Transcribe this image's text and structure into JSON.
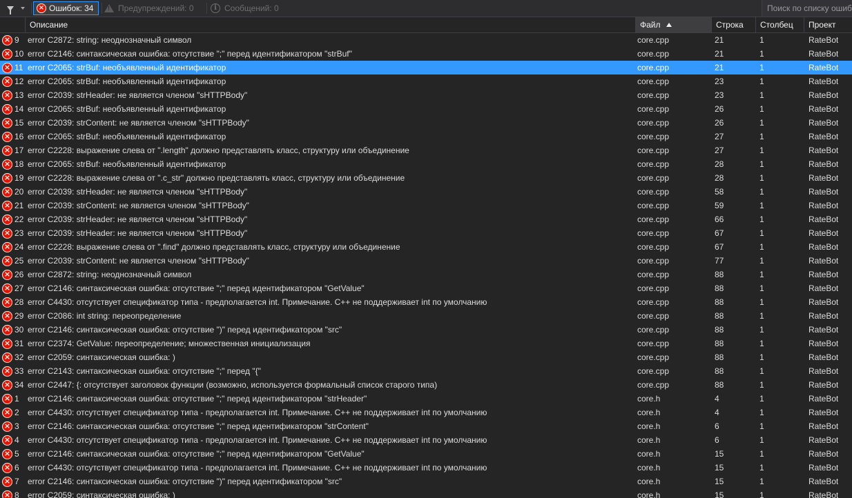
{
  "toolbar": {
    "errors_label": "Ошибок: 34",
    "warnings_label": "Предупреждений: 0",
    "messages_label": "Сообщений: 0",
    "search_placeholder": "Поиск по списку ошибок"
  },
  "columns": {
    "description": "Описание",
    "file": "Файл",
    "line": "Строка",
    "column": "Столбец",
    "project": "Проект"
  },
  "selected_index": 2,
  "rows": [
    {
      "n": "9",
      "desc": "error C2872: string: неоднозначный символ",
      "file": "core.cpp",
      "line": "21",
      "col": "1",
      "proj": "RateBot"
    },
    {
      "n": "10",
      "desc": "error C2146: синтаксическая ошибка: отсутствие \";\" перед идентификатором \"strBuf\"",
      "file": "core.cpp",
      "line": "21",
      "col": "1",
      "proj": "RateBot"
    },
    {
      "n": "11",
      "desc": "error C2065: strBuf: необъявленный идентификатор",
      "file": "core.cpp",
      "line": "21",
      "col": "1",
      "proj": "RateBot"
    },
    {
      "n": "12",
      "desc": "error C2065: strBuf: необъявленный идентификатор",
      "file": "core.cpp",
      "line": "23",
      "col": "1",
      "proj": "RateBot"
    },
    {
      "n": "13",
      "desc": "error C2039: strHeader: не является членом \"sHTTPBody\"",
      "file": "core.cpp",
      "line": "23",
      "col": "1",
      "proj": "RateBot"
    },
    {
      "n": "14",
      "desc": "error C2065: strBuf: необъявленный идентификатор",
      "file": "core.cpp",
      "line": "26",
      "col": "1",
      "proj": "RateBot"
    },
    {
      "n": "15",
      "desc": "error C2039: strContent: не является членом \"sHTTPBody\"",
      "file": "core.cpp",
      "line": "26",
      "col": "1",
      "proj": "RateBot"
    },
    {
      "n": "16",
      "desc": "error C2065: strBuf: необъявленный идентификатор",
      "file": "core.cpp",
      "line": "27",
      "col": "1",
      "proj": "RateBot"
    },
    {
      "n": "17",
      "desc": "error C2228: выражение слева от \".length\" должно представлять класс, структуру или объединение",
      "file": "core.cpp",
      "line": "27",
      "col": "1",
      "proj": "RateBot"
    },
    {
      "n": "18",
      "desc": "error C2065: strBuf: необъявленный идентификатор",
      "file": "core.cpp",
      "line": "28",
      "col": "1",
      "proj": "RateBot"
    },
    {
      "n": "19",
      "desc": "error C2228: выражение слева от \".c_str\" должно представлять класс, структуру или объединение",
      "file": "core.cpp",
      "line": "28",
      "col": "1",
      "proj": "RateBot"
    },
    {
      "n": "20",
      "desc": "error C2039: strHeader: не является членом \"sHTTPBody\"",
      "file": "core.cpp",
      "line": "58",
      "col": "1",
      "proj": "RateBot"
    },
    {
      "n": "21",
      "desc": "error C2039: strContent: не является членом \"sHTTPBody\"",
      "file": "core.cpp",
      "line": "59",
      "col": "1",
      "proj": "RateBot"
    },
    {
      "n": "22",
      "desc": "error C2039: strHeader: не является членом \"sHTTPBody\"",
      "file": "core.cpp",
      "line": "66",
      "col": "1",
      "proj": "RateBot"
    },
    {
      "n": "23",
      "desc": "error C2039: strHeader: не является членом \"sHTTPBody\"",
      "file": "core.cpp",
      "line": "67",
      "col": "1",
      "proj": "RateBot"
    },
    {
      "n": "24",
      "desc": "error C2228: выражение слева от \".find\" должно представлять класс, структуру или объединение",
      "file": "core.cpp",
      "line": "67",
      "col": "1",
      "proj": "RateBot"
    },
    {
      "n": "25",
      "desc": "error C2039: strContent: не является членом \"sHTTPBody\"",
      "file": "core.cpp",
      "line": "77",
      "col": "1",
      "proj": "RateBot"
    },
    {
      "n": "26",
      "desc": "error C2872: string: неоднозначный символ",
      "file": "core.cpp",
      "line": "88",
      "col": "1",
      "proj": "RateBot"
    },
    {
      "n": "27",
      "desc": "error C2146: синтаксическая ошибка: отсутствие \";\" перед идентификатором \"GetValue\"",
      "file": "core.cpp",
      "line": "88",
      "col": "1",
      "proj": "RateBot"
    },
    {
      "n": "28",
      "desc": "error C4430: отсутствует спецификатор типа - предполагается int. Примечание. C++ не поддерживает int по умолчанию",
      "file": "core.cpp",
      "line": "88",
      "col": "1",
      "proj": "RateBot"
    },
    {
      "n": "29",
      "desc": "error C2086: int string: переопределение",
      "file": "core.cpp",
      "line": "88",
      "col": "1",
      "proj": "RateBot"
    },
    {
      "n": "30",
      "desc": "error C2146: синтаксическая ошибка: отсутствие \")\" перед идентификатором \"src\"",
      "file": "core.cpp",
      "line": "88",
      "col": "1",
      "proj": "RateBot"
    },
    {
      "n": "31",
      "desc": "error C2374: GetValue: переопределение; множественная инициализация",
      "file": "core.cpp",
      "line": "88",
      "col": "1",
      "proj": "RateBot"
    },
    {
      "n": "32",
      "desc": "error C2059: синтаксическая ошибка: )",
      "file": "core.cpp",
      "line": "88",
      "col": "1",
      "proj": "RateBot"
    },
    {
      "n": "33",
      "desc": "error C2143: синтаксическая ошибка: отсутствие \";\" перед \"{\"",
      "file": "core.cpp",
      "line": "88",
      "col": "1",
      "proj": "RateBot"
    },
    {
      "n": "34",
      "desc": "error C2447: {: отсутствует заголовок функции (возможно, используется формальный список старого типа)",
      "file": "core.cpp",
      "line": "88",
      "col": "1",
      "proj": "RateBot"
    },
    {
      "n": "1",
      "desc": "error C2146: синтаксическая ошибка: отсутствие \";\" перед идентификатором \"strHeader\"",
      "file": "core.h",
      "line": "4",
      "col": "1",
      "proj": "RateBot"
    },
    {
      "n": "2",
      "desc": "error C4430: отсутствует спецификатор типа - предполагается int. Примечание. C++ не поддерживает int по умолчанию",
      "file": "core.h",
      "line": "4",
      "col": "1",
      "proj": "RateBot"
    },
    {
      "n": "3",
      "desc": "error C2146: синтаксическая ошибка: отсутствие \";\" перед идентификатором \"strContent\"",
      "file": "core.h",
      "line": "6",
      "col": "1",
      "proj": "RateBot"
    },
    {
      "n": "4",
      "desc": "error C4430: отсутствует спецификатор типа - предполагается int. Примечание. C++ не поддерживает int по умолчанию",
      "file": "core.h",
      "line": "6",
      "col": "1",
      "proj": "RateBot"
    },
    {
      "n": "5",
      "desc": "error C2146: синтаксическая ошибка: отсутствие \";\" перед идентификатором \"GetValue\"",
      "file": "core.h",
      "line": "15",
      "col": "1",
      "proj": "RateBot"
    },
    {
      "n": "6",
      "desc": "error C4430: отсутствует спецификатор типа - предполагается int. Примечание. C++ не поддерживает int по умолчанию",
      "file": "core.h",
      "line": "15",
      "col": "1",
      "proj": "RateBot"
    },
    {
      "n": "7",
      "desc": "error C2146: синтаксическая ошибка: отсутствие \")\" перед идентификатором \"src\"",
      "file": "core.h",
      "line": "15",
      "col": "1",
      "proj": "RateBot"
    },
    {
      "n": "8",
      "desc": "error C2059: синтаксическая ошибка: )",
      "file": "core.h",
      "line": "15",
      "col": "1",
      "proj": "RateBot"
    }
  ]
}
